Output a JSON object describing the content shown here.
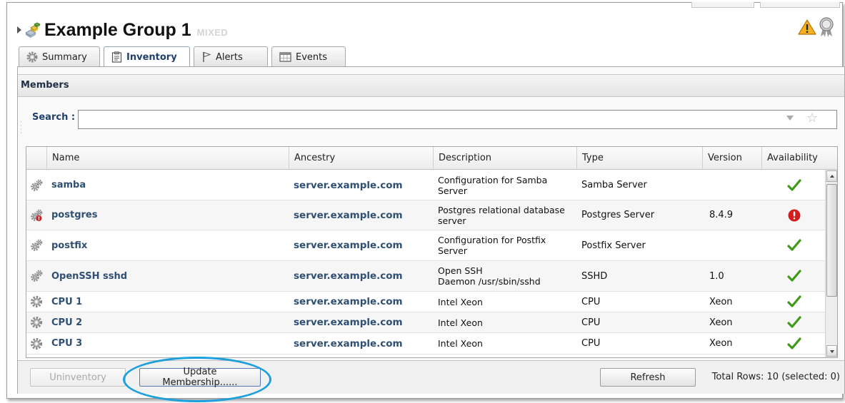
{
  "header": {
    "title": "Example Group 1",
    "subtitle": "MIXED",
    "icons": [
      "expand-arrow",
      "group-icon",
      "warning-icon",
      "badge-icon"
    ]
  },
  "tabs": [
    {
      "label": "Summary",
      "icon": "gear-icon",
      "active": false
    },
    {
      "label": "Inventory",
      "icon": "clipboard-icon",
      "active": true
    },
    {
      "label": "Alerts",
      "icon": "flag-icon",
      "active": false
    },
    {
      "label": "Events",
      "icon": "calendar-icon",
      "active": false
    }
  ],
  "members": {
    "title": "Members",
    "search_label": "Search :",
    "search_value": ""
  },
  "table": {
    "columns": [
      "Name",
      "Ancestry",
      "Description",
      "Type",
      "Version",
      "Availability"
    ],
    "rows": [
      {
        "name": "samba",
        "ancestry": "server.example.com",
        "desc1": "Configuration for Samba",
        "desc2": "Server",
        "type": "Samba Server",
        "version": "",
        "availability": "up",
        "icon": "cogs-icon"
      },
      {
        "name": "postgres",
        "ancestry": "server.example.com",
        "desc1": "Postgres relational database",
        "desc2": "server",
        "type": "Postgres Server",
        "version": "8.4.9",
        "availability": "down",
        "icon": "cogs-error-icon"
      },
      {
        "name": "postfix",
        "ancestry": "server.example.com",
        "desc1": "Configuration for Postfix",
        "desc2": "Server",
        "type": "Postfix Server",
        "version": "",
        "availability": "up",
        "icon": "cogs-icon"
      },
      {
        "name": "OpenSSH sshd",
        "ancestry": "server.example.com",
        "desc1": "Open SSH",
        "desc2": "Daemon /usr/sbin/sshd",
        "type": "SSHD",
        "version": "1.0",
        "availability": "up",
        "icon": "cogs-icon"
      },
      {
        "name": "CPU 1",
        "ancestry": "server.example.com",
        "desc1": "Intel Xeon",
        "desc2": "",
        "type": "CPU",
        "version": "Xeon",
        "availability": "up",
        "icon": "gear-icon"
      },
      {
        "name": "CPU 2",
        "ancestry": "server.example.com",
        "desc1": "Intel Xeon",
        "desc2": "",
        "type": "CPU",
        "version": "Xeon",
        "availability": "up",
        "icon": "gear-icon"
      },
      {
        "name": "CPU 3",
        "ancestry": "server.example.com",
        "desc1": "Intel Xeon",
        "desc2": "",
        "type": "CPU",
        "version": "Xeon",
        "availability": "up",
        "icon": "gear-icon"
      }
    ]
  },
  "footer": {
    "uninventory_label": "Uninventory",
    "update_label": "Update Membership......",
    "refresh_label": "Refresh",
    "total_rows": "Total Rows: 10 (selected: 0)"
  },
  "colors": {
    "link": "#2f4f72",
    "available": "#3f9a1a",
    "unavailable": "#d11d1d",
    "highlight": "#1da0dc"
  }
}
